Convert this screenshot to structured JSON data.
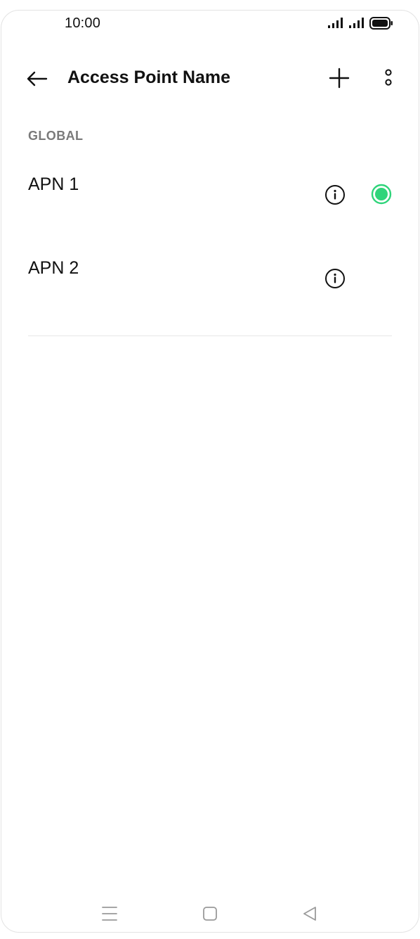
{
  "status_bar": {
    "time": "10:00",
    "icons": [
      "signal-icon",
      "signal-icon",
      "battery-icon"
    ]
  },
  "app_bar": {
    "back_icon": "arrow-left-icon",
    "title": "Access Point Name",
    "add_icon": "plus-icon",
    "more_icon": "more-vertical-icon"
  },
  "section": {
    "header": "GLOBAL"
  },
  "apns": [
    {
      "name": "APN 1",
      "selected": true,
      "info_icon": "info-icon"
    },
    {
      "name": "APN 2",
      "selected": false,
      "info_icon": "info-icon"
    }
  ],
  "nav_bar": {
    "icons": [
      "menu-icon",
      "home-square-icon",
      "back-triangle-icon"
    ]
  },
  "colors": {
    "accent": "#2fd47a",
    "text": "#111111",
    "section_header": "#7a7a7a",
    "divider": "#e6e6e6",
    "nav_icon": "#9a9a9a"
  }
}
